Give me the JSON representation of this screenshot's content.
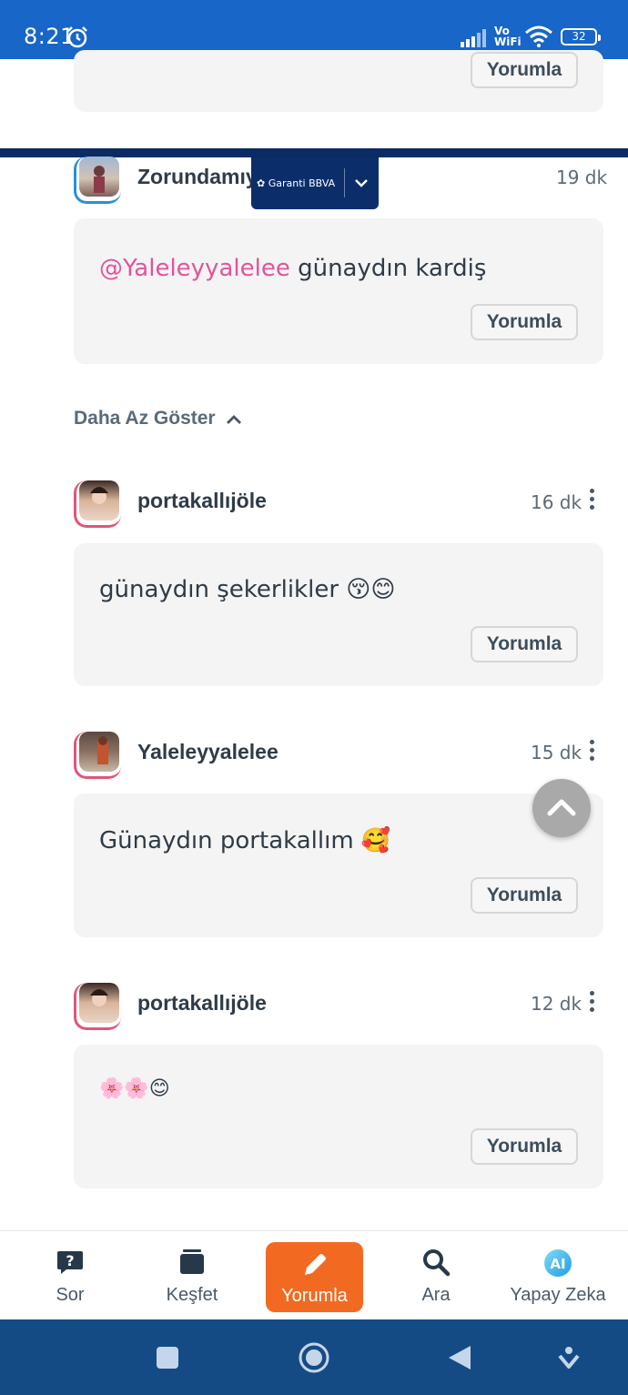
{
  "status_bar": {
    "time": "8:21",
    "network": "Vo WiFi",
    "battery": "32"
  },
  "colors": {
    "status_bar": "#1766c8",
    "card_bg": "#f4f4f4",
    "mention": "#e0559a",
    "active_nav": "#f26a21",
    "system_nav": "#154b85",
    "ad_banner": "#0b2e6b"
  },
  "top_card": {
    "reply_label": "Yorumla"
  },
  "ad": {
    "brand": "Garanti BBVA"
  },
  "comments": [
    {
      "username": "Zorundamıy",
      "time": "19 dk",
      "mention": "@Yaleleyyalelee",
      "text": "günaydın kardiş",
      "reply_label": "Yorumla"
    }
  ],
  "show_less": {
    "label": "Daha Az Göster"
  },
  "comments2": [
    {
      "username": "portakallıjöle",
      "time": "16 dk",
      "text": "günaydın şekerlikler 😚😊",
      "reply_label": "Yorumla"
    },
    {
      "username": "Yaleleyyalelee",
      "time": "15 dk",
      "text": "Günaydın portakallım 🥰",
      "reply_label": "Yorumla"
    },
    {
      "username": "portakallıjöle",
      "time": "12 dk",
      "text": "🌸🌸😊",
      "reply_label": "Yorumla"
    }
  ],
  "bottom_nav": [
    {
      "label": "Sor",
      "icon": "question-bubble-icon"
    },
    {
      "label": "Keşfet",
      "icon": "cards-stack-icon"
    },
    {
      "label": "Yorumla",
      "icon": "pencil-icon",
      "active": true
    },
    {
      "label": "Ara",
      "icon": "search-icon"
    },
    {
      "label": "Yapay Zeka",
      "icon": "ai-icon"
    }
  ]
}
